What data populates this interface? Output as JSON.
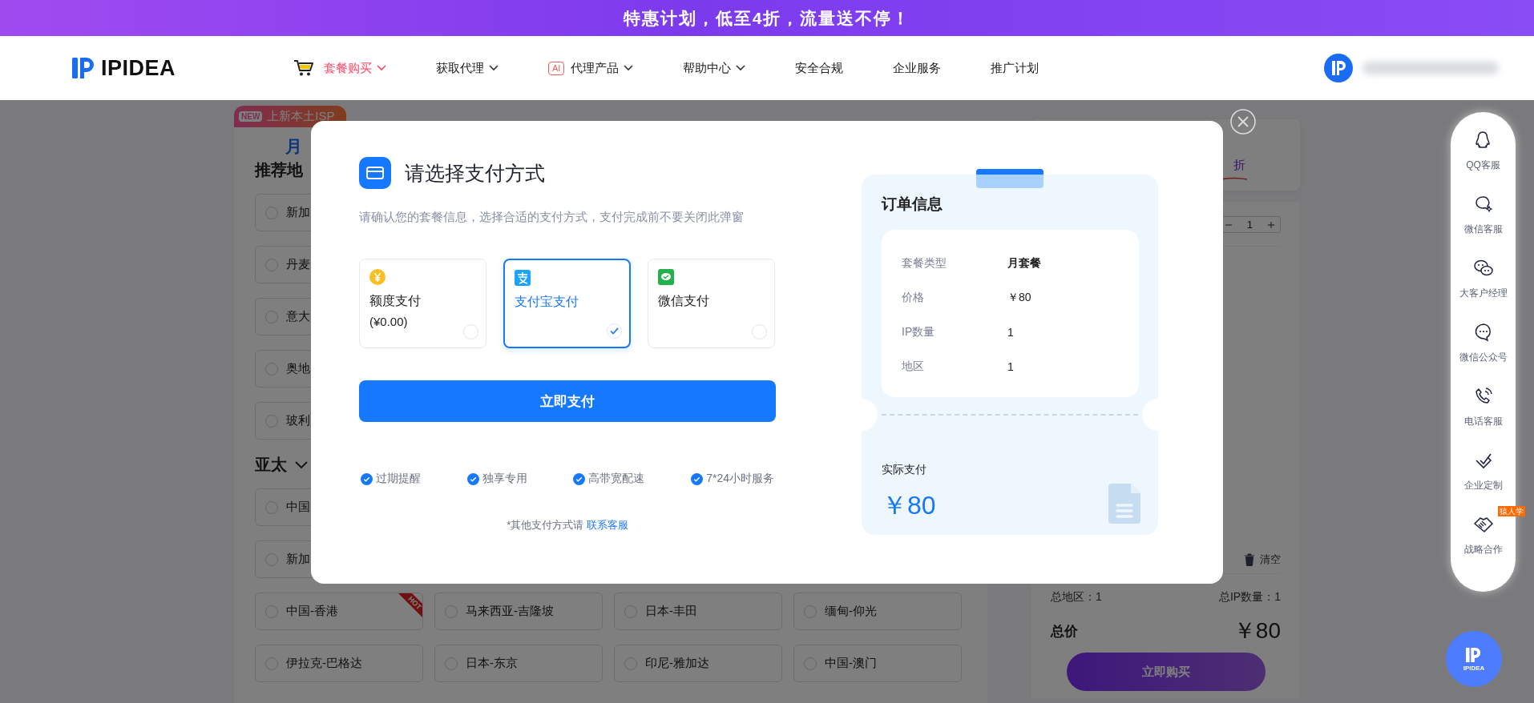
{
  "banner": {
    "text": "特惠计划，低至**4**折，流量送不停！"
  },
  "header": {
    "logo": "IPIDEA",
    "nav": [
      {
        "label": "套餐购买",
        "selected": true,
        "dropdown": true
      },
      {
        "label": "获取代理",
        "selected": false,
        "dropdown": true
      },
      {
        "label": "代理产品",
        "selected": false,
        "dropdown": true,
        "badge": "AI"
      },
      {
        "label": "帮助中心",
        "selected": false,
        "dropdown": true
      },
      {
        "label": "安全合规",
        "selected": false,
        "dropdown": false
      },
      {
        "label": "企业服务",
        "selected": false,
        "dropdown": false
      },
      {
        "label": "推广计划",
        "selected": false,
        "dropdown": false
      }
    ]
  },
  "plans": {
    "promo_tag": {
      "badge": "NEW",
      "text": "上新本土ISP"
    },
    "tab": "月",
    "sections": [
      {
        "title": "推荐地",
        "expandable": false,
        "rows": [
          [
            {
              "name": "新加",
              "checked": false
            }
          ],
          [
            {
              "name": "丹麦",
              "checked": false
            }
          ],
          [
            {
              "name": "意大",
              "checked": false
            }
          ],
          [
            {
              "name": "奥地",
              "checked": false
            }
          ],
          [
            {
              "name": "玻利",
              "checked": false
            }
          ]
        ]
      },
      {
        "title": "亚太",
        "expandable": true,
        "rows": [
          [
            {
              "name": "中国",
              "checked": false
            }
          ],
          [
            {
              "name": "新加",
              "checked": false
            }
          ],
          [
            {
              "name": "中国-香港",
              "checked": false,
              "ribbon": "HOT"
            },
            {
              "name": "马来西亚-吉隆坡",
              "checked": false
            },
            {
              "name": "日本-丰田",
              "checked": false
            },
            {
              "name": "缅甸-仰光",
              "checked": false
            }
          ],
          [
            {
              "name": "伊拉克-巴格达",
              "checked": false
            },
            {
              "name": "日本-东京",
              "checked": false
            },
            {
              "name": "印尼-雅加达",
              "checked": false
            },
            {
              "name": "中国-澳门",
              "checked": false
            }
          ]
        ]
      }
    ]
  },
  "order_panel": {
    "discount_suffix": "折",
    "quantity": "1",
    "clear": "清空",
    "total_regions": "总地区：1",
    "total_ip": "总IP数量：1",
    "total_label": "总价",
    "total_price": "￥80",
    "buy_button": "立即购买"
  },
  "payment_modal": {
    "title": "请选择支付方式",
    "subtitle": "请确认您的套餐信息，选择合适的支付方式，支付完成前不要关闭此弹窗",
    "methods": [
      {
        "kind": "balance",
        "label": "额度支付",
        "note": "(¥0.00)",
        "selected": false
      },
      {
        "kind": "alipay",
        "label": "支付宝支付",
        "selected": true
      },
      {
        "kind": "wechat",
        "label": "微信支付",
        "selected": false
      }
    ],
    "pay_button": "立即支付",
    "features": [
      "过期提醒",
      "独享专用",
      "高带宽配速",
      "7*24小时服务"
    ],
    "footer": {
      "text": "*其他支付方式请",
      "link": "联系客服"
    },
    "order": {
      "title": "订单信息",
      "rows": [
        {
          "label": "套餐类型",
          "value": "月套餐"
        },
        {
          "label": "价格",
          "value": "￥80"
        },
        {
          "label": "IP数量",
          "value": "1"
        },
        {
          "label": "地区",
          "value": "1"
        }
      ],
      "paid_label": "实际支付",
      "paid_amount": "￥80"
    }
  },
  "float_bar": [
    {
      "label": "QQ客服"
    },
    {
      "label": "微信客服"
    },
    {
      "label": "大客户经理"
    },
    {
      "label": "微信公众号"
    },
    {
      "label": "电话客服"
    },
    {
      "label": "企业定制"
    },
    {
      "label": "战略合作",
      "badge": "猿人学"
    }
  ],
  "float_logo": "IPIDEA"
}
